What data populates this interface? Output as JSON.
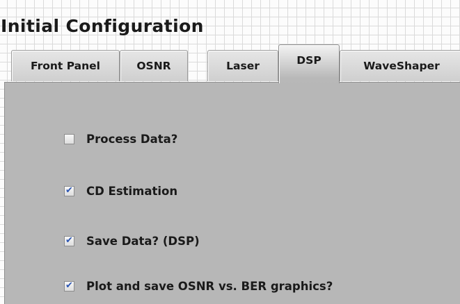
{
  "window": {
    "title": "Initial Configuration"
  },
  "tabs": [
    {
      "label": "Front Panel",
      "active": false
    },
    {
      "label": "OSNR",
      "active": false
    },
    {
      "label": "Laser",
      "active": false
    },
    {
      "label": "DSP",
      "active": true
    },
    {
      "label": "WaveShaper",
      "active": false
    }
  ],
  "dsp": {
    "options": [
      {
        "label": "Process Data?",
        "checked": false
      },
      {
        "label": "CD Estimation",
        "checked": true
      },
      {
        "label": "Save Data? (DSP)",
        "checked": true
      },
      {
        "label": "Plot and save OSNR vs. BER graphics?",
        "checked": true
      }
    ]
  },
  "colors": {
    "panel": "#b7b7b7",
    "checkmark": "#2c56b3",
    "grid": "#dadada"
  },
  "icons": {
    "checkmark": "check-icon"
  }
}
